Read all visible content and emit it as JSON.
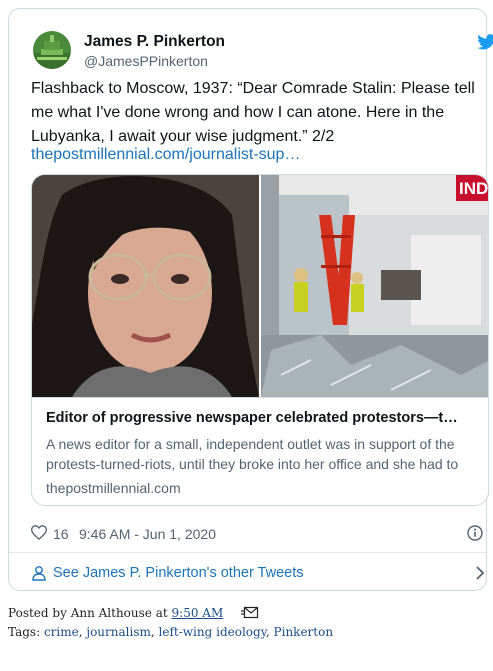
{
  "tweet": {
    "author_name": "James P. Pinkerton",
    "author_handle": "@JamesPPinkerton",
    "text_lines": [
      "Flashback to Moscow, 1937: “Dear Comrade Stalin: Please tell",
      "me what I've done wrong and how I can atone.  Here in the",
      "Lubyanka, I await your wise judgment.” 2/2"
    ],
    "link_text": "thepostmillennial.com/journalist-sup…",
    "card": {
      "title": "Editor of progressive newspaper celebrated protestors—t…",
      "description": "A news editor for a small, independent outlet was in support of the protests-turned-riots, until they broke into her office and she had to",
      "domain": "thepostmillennial.com"
    },
    "like_count": "16",
    "time": "9:46 AM - Jun 1, 2020",
    "see_more": "See James P. Pinkerton's other Tweets",
    "icons": {
      "brand": "twitter-bird-icon",
      "like": "heart-icon",
      "info": "info-icon",
      "profile": "person-icon",
      "next": "chevron-right-icon"
    },
    "colors": {
      "twitter_blue": "#1d9bf0",
      "link_blue": "#1b74b8",
      "secondary_text": "#536471"
    }
  },
  "post_footer": {
    "posted_by_prefix": "Posted by",
    "author": "Ann Althouse",
    "at": "at",
    "time": "9:50 AM",
    "tags_label": "Tags:",
    "tags": [
      "crime",
      "journalism",
      "left-wing ideology",
      "Pinkerton"
    ]
  }
}
